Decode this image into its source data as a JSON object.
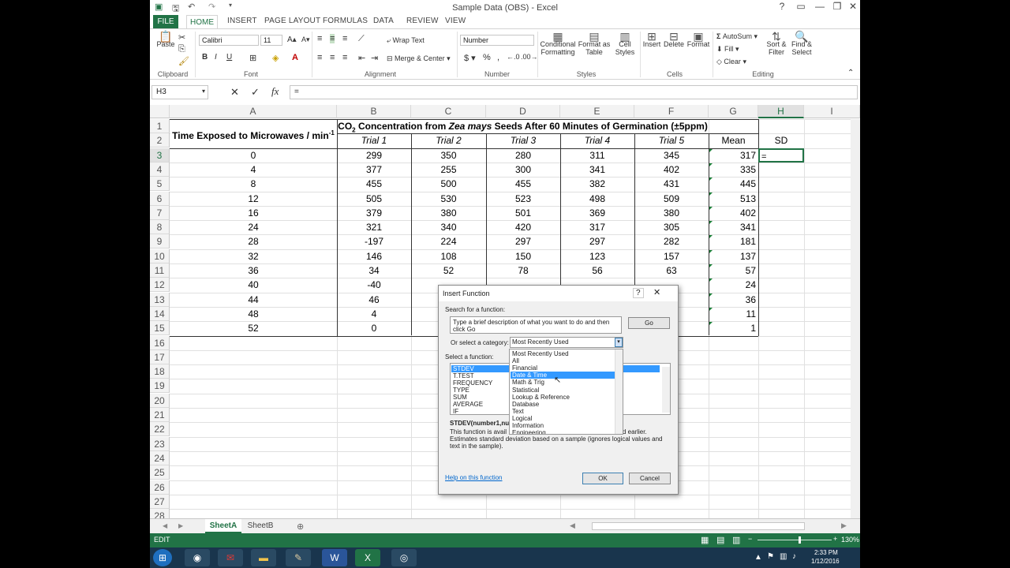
{
  "window": {
    "title": "Sample Data (OBS) - Excel"
  },
  "ribbon_tabs": [
    "FILE",
    "HOME",
    "INSERT",
    "PAGE LAYOUT",
    "FORMULAS",
    "DATA",
    "REVIEW",
    "VIEW"
  ],
  "ribbon": {
    "paste": "Paste",
    "font_name": "Calibri",
    "font_size": "11",
    "wrap_text": "Wrap Text",
    "merge_center": "Merge & Center",
    "number_format": "Number",
    "conditional_formatting": "Conditional Formatting",
    "format_as_table": "Format as Table",
    "cell_styles": "Cell Styles",
    "insert": "Insert",
    "delete": "Delete",
    "format": "Format",
    "autosum": "AutoSum",
    "fill": "Fill",
    "clear": "Clear",
    "sort_filter": "Sort & Filter",
    "find_select": "Find & Select",
    "groups": {
      "clipboard": "Clipboard",
      "font": "Font",
      "alignment": "Alignment",
      "number": "Number",
      "styles": "Styles",
      "cells": "Cells",
      "editing": "Editing"
    }
  },
  "formula_bar": {
    "name_box": "H3",
    "fx": "fx",
    "value": "="
  },
  "columns": [
    "A",
    "B",
    "C",
    "D",
    "E",
    "F",
    "G",
    "H",
    "I"
  ],
  "rows": [
    "1",
    "2",
    "3",
    "4",
    "5",
    "6",
    "7",
    "8",
    "9",
    "10",
    "11",
    "12",
    "13",
    "14",
    "15",
    "16",
    "17",
    "18",
    "19",
    "20",
    "21",
    "22",
    "23",
    "24",
    "25",
    "26",
    "27",
    "28"
  ],
  "sheet": {
    "a_header": "Time Exposed to Microwaves / min",
    "a_header_sup": "-1",
    "b_header_pre": "CO",
    "b_header_sub": "2",
    "b_header_mid": " Concentration from ",
    "b_header_italic": "Zea mays",
    "b_header_post": " Seeds After 60 Minutes of Germination (±5ppm)",
    "trials": [
      "Trial 1",
      "Trial 2",
      "Trial 3",
      "Trial 4",
      "Trial 5"
    ],
    "mean": "Mean",
    "sd": "SD",
    "h3": "=",
    "data": [
      [
        "0",
        "299",
        "350",
        "280",
        "311",
        "345",
        "317"
      ],
      [
        "4",
        "377",
        "255",
        "300",
        "341",
        "402",
        "335"
      ],
      [
        "8",
        "455",
        "500",
        "455",
        "382",
        "431",
        "445"
      ],
      [
        "12",
        "505",
        "530",
        "523",
        "498",
        "509",
        "513"
      ],
      [
        "16",
        "379",
        "380",
        "501",
        "369",
        "380",
        "402"
      ],
      [
        "24",
        "321",
        "340",
        "420",
        "317",
        "305",
        "341"
      ],
      [
        "28",
        "-197",
        "224",
        "297",
        "297",
        "282",
        "181"
      ],
      [
        "32",
        "146",
        "108",
        "150",
        "123",
        "157",
        "137"
      ],
      [
        "36",
        "34",
        "52",
        "78",
        "56",
        "63",
        "57"
      ],
      [
        "40",
        "-40",
        "",
        "",
        "",
        "",
        "24"
      ],
      [
        "44",
        "46",
        "",
        "",
        "",
        "",
        "36"
      ],
      [
        "48",
        "4",
        "",
        "",
        "",
        "",
        "11"
      ],
      [
        "52",
        "0",
        "",
        "",
        "",
        "",
        "1"
      ]
    ]
  },
  "sheet_tabs": [
    "SheetA",
    "SheetB"
  ],
  "status": {
    "mode": "EDIT",
    "zoom": "130%"
  },
  "taskbar": {
    "time": "2:33 PM",
    "date": "1/12/2016"
  },
  "dialog": {
    "title": "Insert Function",
    "search_label": "Search for a function:",
    "search_text": "Type a brief description of what you want to do and then click Go",
    "go": "Go",
    "category_label": "Or select a category:",
    "category_value": "Most Recently Used",
    "categories": [
      "Most Recently Used",
      "All",
      "Financial",
      "Date & Time",
      "Math & Trig",
      "Statistical",
      "Lookup & Reference",
      "Database",
      "Text",
      "Logical",
      "Information",
      "Engineering"
    ],
    "select_label": "Select a function:",
    "functions": [
      "STDEV",
      "T.TEST",
      "FREQUENCY",
      "TYPE",
      "SUM",
      "AVERAGE",
      "IF"
    ],
    "signature": "STDEV(number1,num",
    "desc1a": "This function is avail",
    "desc1b": "d earlier.",
    "desc2": "Estimates standard deviation based on a sample (ignores logical values and",
    "desc3": "text in the sample).",
    "help": "Help on this function",
    "ok": "OK",
    "cancel": "Cancel"
  }
}
